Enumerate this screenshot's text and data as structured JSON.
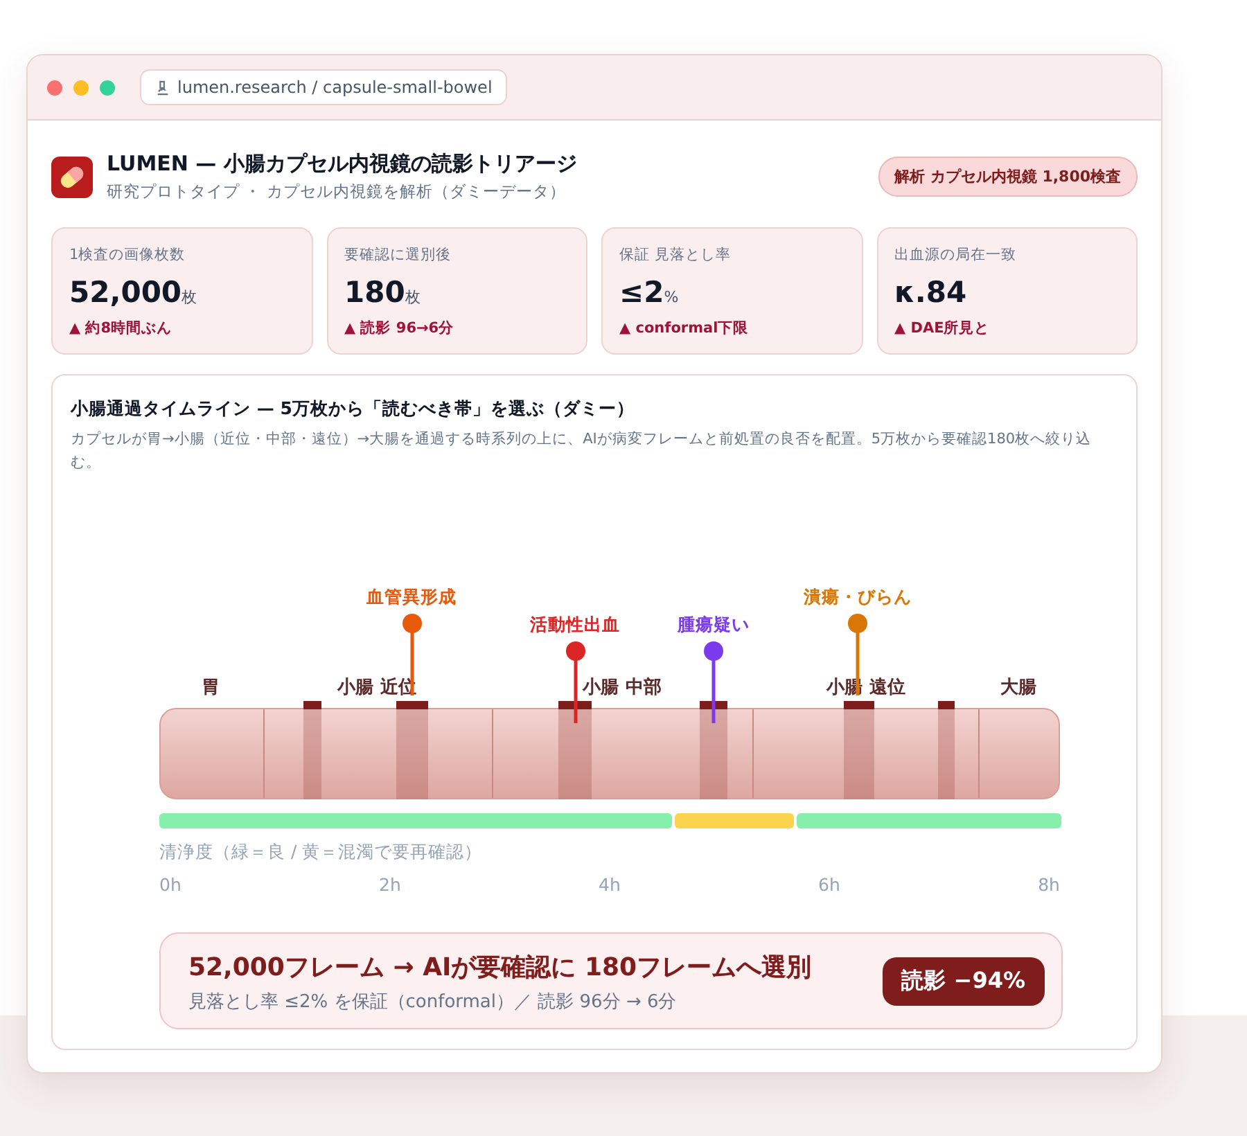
{
  "window": {
    "url": "lumen.research / capsule-small-bowel"
  },
  "header": {
    "title": "LUMEN — 小腸カプセル内視鏡の読影トリアージ",
    "subtitle": "研究プロトタイプ ・ カプセル内視鏡を解析（ダミーデータ）",
    "badge": "解析 カプセル内視鏡 1,800検査"
  },
  "stats": [
    {
      "label": "1検査の画像枚数",
      "value": "52,000",
      "unit": "枚",
      "note": "▲ 約8時間ぶん"
    },
    {
      "label": "要確認に選別後",
      "value": "180",
      "unit": "枚",
      "note": "▲ 読影 96→6分"
    },
    {
      "label": "保証 見落とし率",
      "value": "≤2",
      "unit": "%",
      "note": "▲ conformal下限"
    },
    {
      "label": "出血源の局在一致",
      "value": "κ.84",
      "note": "▲ DAE所見と"
    }
  ],
  "timeline": {
    "title": "小腸通過タイムライン — 5万枚から「読むべき帯」を選ぶ（ダミー）",
    "description": "カプセルが胃→小腸（近位・中部・遠位）→大腸を通過する時系列の上に、AIが病変フレームと前処置の良否を配置。5万枚から要確認180枚へ絞り込む。",
    "segments": [
      "胃",
      "小腸 近位",
      "小腸 中部",
      "小腸 遠位",
      "大腸"
    ],
    "lesions": [
      {
        "label": "血管異形成",
        "color": "#e8590c"
      },
      {
        "label": "活動性出血",
        "color": "#dc2626"
      },
      {
        "label": "腫瘍疑い",
        "color": "#7c3aed"
      },
      {
        "label": "潰瘍・びらん",
        "color": "#d97706"
      }
    ],
    "cleanliness": [
      {
        "kind": "good"
      },
      {
        "kind": "poor"
      },
      {
        "kind": "good"
      }
    ],
    "cleanliness_caption": "清浄度（緑＝良 / 黄＝混濁で要再確認）",
    "ticks": [
      "0h",
      "2h",
      "4h",
      "6h",
      "8h"
    ]
  },
  "summary": {
    "title": "52,000フレーム → AIが要確認に 180フレームへ選別",
    "subtitle": "見落とし率 ≤2% を保証（conformal）／ 読影 96分 → 6分",
    "badge": "読影 −94%"
  }
}
